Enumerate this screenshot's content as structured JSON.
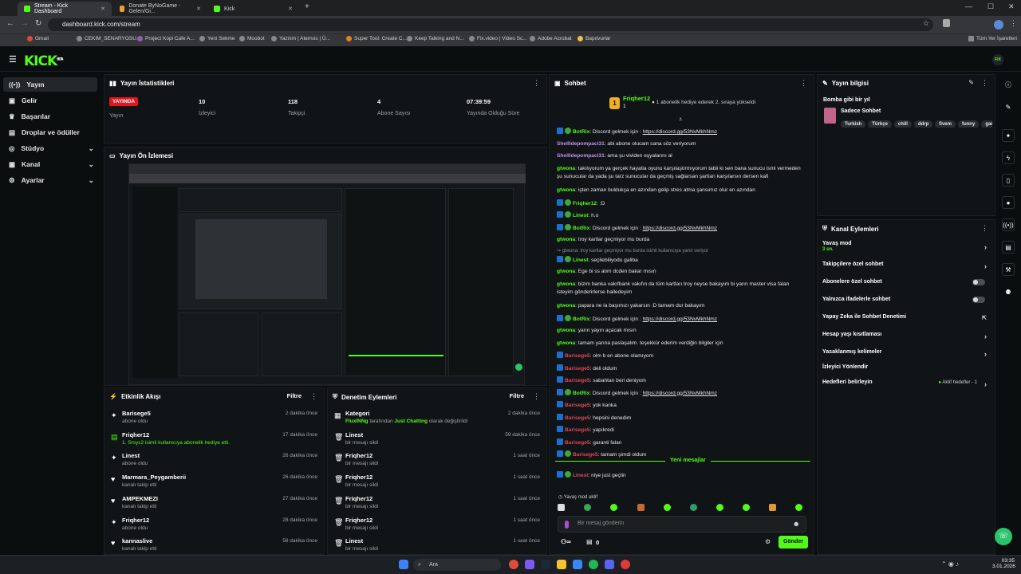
{
  "browser": {
    "tabs": [
      {
        "title": "Stream - Kick Dashboard",
        "active": true
      },
      {
        "title": "Donate ByNoGame - Gelen/Gi...",
        "active": false
      },
      {
        "title": "Kick",
        "active": false
      }
    ],
    "url": "dashboard.kick.com/stream",
    "bookmarks": [
      "Gmail",
      "CEKIM_SENARYOSU...",
      "Project Kopi Cafe A...",
      "Yeni Sekme",
      "Moobot",
      "Yazılım | Aternos | Ü...",
      "Super Tool: Create C...",
      "Keep Talking and N...",
      "Fix.video | Video Sc...",
      "Adobe Acrobat",
      "Bapıtvurlar"
    ],
    "all_bookmarks": "Tüm Yer İşaretleri"
  },
  "kick": {
    "logo": "KICK",
    "logo_sup": "BETA",
    "user_tag": "FIX"
  },
  "sidebar": [
    {
      "label": "Yayın",
      "icon": "broadcast-icon",
      "selected": true
    },
    {
      "label": "Gelir",
      "icon": "wallet-icon"
    },
    {
      "label": "Başarılar",
      "icon": "trophy-icon"
    },
    {
      "label": "Droplar ve ödüller",
      "icon": "gift-icon"
    },
    {
      "label": "Stüdyo",
      "icon": "studio-icon",
      "chevron": true
    },
    {
      "label": "Kanal",
      "icon": "channel-icon",
      "chevron": true
    },
    {
      "label": "Ayarlar",
      "icon": "gear-icon",
      "chevron": true
    }
  ],
  "stats": {
    "title": "Yayın İstatistikleri",
    "live_badge": "YAYINDA",
    "live_label": "Yayın",
    "items": [
      {
        "value": "10",
        "label": "İzleyici"
      },
      {
        "value": "118",
        "label": "Takipçi"
      },
      {
        "value": "4",
        "label": "Abone Sayısı"
      },
      {
        "value": "07:39:59",
        "label": "Yayında Olduğu Süre"
      }
    ]
  },
  "preview": {
    "title": "Yayın Ön İzlemesi"
  },
  "activity": {
    "title": "Etkinlik Akışı",
    "filter": "Filtre",
    "items": [
      {
        "name": "Barisege5",
        "desc": "abone oldu",
        "time": "2 dakika önce",
        "icon": "star-icon"
      },
      {
        "name": "Friqher12",
        "desc": "1. Srsys2 isimli kullanıcıya abonelik hediye etti.",
        "time": "17 dakika önce",
        "icon": "gift-icon",
        "green": true
      },
      {
        "name": "Linest",
        "desc": "abone oldu",
        "time": "26 dakika önce",
        "icon": "star-icon"
      },
      {
        "name": "Marmara_Peygamberii",
        "desc": "kanalı takip etti",
        "time": "26 dakika önce",
        "icon": "heart-icon"
      },
      {
        "name": "AMPEKMEZI",
        "desc": "kanalı takip etti",
        "time": "27 dakika önce",
        "icon": "heart-icon"
      },
      {
        "name": "Friqher12",
        "desc": "abone oldu",
        "time": "28 dakika önce",
        "icon": "star-icon"
      },
      {
        "name": "kannaslive",
        "desc": "kanalı takip etti",
        "time": "58 dakika önce",
        "icon": "heart-icon"
      }
    ]
  },
  "moderation": {
    "title": "Denetim Eylemleri",
    "filter": "Filtre",
    "items": [
      {
        "name": "Kategori",
        "desc_user": "FluxINNg",
        "desc_mid": " tarafından ",
        "desc_cat": "Just Chatting",
        "desc_end": " olarak değiştirildi",
        "time": "2 dakika önce",
        "icon": "category-icon"
      },
      {
        "name": "Linest",
        "desc": "bir mesajı sildi",
        "time": "59 dakika önce",
        "icon": "trash-icon"
      },
      {
        "name": "Friqher12",
        "desc": "bir mesajı sildi",
        "time": "1 saat önce",
        "icon": "trash-icon"
      },
      {
        "name": "Friqher12",
        "desc": "bir mesajı sildi",
        "time": "1 saat önce",
        "icon": "trash-icon"
      },
      {
        "name": "Friqher12",
        "desc": "bir mesajı sildi",
        "time": "1 saat önce",
        "icon": "trash-icon"
      },
      {
        "name": "Friqher12",
        "desc": "bir mesajı sildi",
        "time": "1 saat önce",
        "icon": "trash-icon"
      },
      {
        "name": "Linest",
        "desc": "bir mesajı sildi",
        "time": "1 saat önce",
        "icon": "trash-icon"
      }
    ]
  },
  "chat": {
    "title": "Sohbet",
    "gifter": "Friqher12",
    "gifter_count": "1",
    "gift_msg": "1 abonelik hediye ederek 2. sıraya yükseldi",
    "messages": [
      {
        "user": "BotRix",
        "cls": "u-green",
        "badges": 2,
        "text": "Discord gelmek için : ",
        "link": "https://discord.gg/53NvMkhNmz"
      },
      {
        "user": "Shellldepompaci31",
        "cls": "u-purple",
        "badges": 0,
        "text": "abi abone olucam sana söz veriyorum"
      },
      {
        "user": "Shellldepompaci31",
        "cls": "u-purple",
        "badges": 0,
        "text": "ama şu vividen eşyalarını al"
      },
      {
        "user": "gtwona",
        "cls": "u-green",
        "badges": 0,
        "text": "takılıyorum ya gerçek hayatla oyunu karşılaştırmıyorum tabii ki sen bana sunucu ismi vermeden şu sunucular da yada şu tarz sunucular da geçmiş sağlarsan şartları karşılarsın dersen kafi",
        "lines": 2
      },
      {
        "user": "gtwona",
        "cls": "u-green",
        "badges": 0,
        "text": "işten zaman buldukça en azından gelip stres atma şansımız olur en azından"
      },
      {
        "user": "Friqher12",
        "cls": "u-green",
        "badges": 2,
        "text": ":D"
      },
      {
        "user": "Linest",
        "cls": "u-green",
        "badges": 2,
        "text": "h.o"
      },
      {
        "user": "BotRix",
        "cls": "u-green",
        "badges": 2,
        "text": "Discord gelmek için : ",
        "link": "https://discord.gg/53NvMkhNmz"
      },
      {
        "user": "gtwona",
        "cls": "u-green",
        "badges": 0,
        "text": "troy kartlar geçmiyor mu burda"
      },
      {
        "reply": "gtwona: troy kartlar geçmiyor mu burda isimli kullanıcıya yanıt veriyor"
      },
      {
        "user": "Linest",
        "cls": "u-green",
        "badges": 2,
        "text": "seçilebiliyodu galiba"
      },
      {
        "user": "gtwona",
        "cls": "u-green",
        "badges": 0,
        "text": "Ege bi ss atım dcden bakar mısın"
      },
      {
        "user": "gtwona",
        "cls": "u-green",
        "badges": 0,
        "text": "bizim banka vakıfbank vakıfın da tüm kartları troy neyse bakayım bi yarın master visa falan isteyim gönderirlerse halledeyim",
        "lines": 2
      },
      {
        "user": "gtwona",
        "cls": "u-green",
        "badges": 0,
        "text": "papara ne la başımızı yakarsın :D tamam dur bakayım"
      },
      {
        "user": "BotRix",
        "cls": "u-green",
        "badges": 2,
        "text": "Discord gelmek için : ",
        "link": "https://discord.gg/53NvMkhNmz"
      },
      {
        "user": "gtwona",
        "cls": "u-green",
        "badges": 0,
        "text": "yarın yayın açacak mısın"
      },
      {
        "user": "gtwona",
        "cls": "u-green",
        "badges": 0,
        "text": "tamam yarına paslaşalım. teşekkür ederim verdiğin bilgiler için"
      },
      {
        "user": "Barisege5",
        "cls": "u-red",
        "badges": 1,
        "text": "olm b en abone olamıyom"
      },
      {
        "user": "Barisege5",
        "cls": "u-red",
        "badges": 1,
        "text": "deli oldum"
      },
      {
        "user": "Barisege5",
        "cls": "u-red",
        "badges": 1,
        "text": "sabahtan beri deniyom"
      },
      {
        "user": "BotRix",
        "cls": "u-green",
        "badges": 2,
        "text": "Discord gelmek için : ",
        "link": "https://discord.gg/53NvMkhNmz"
      },
      {
        "user": "Barisege5",
        "cls": "u-red",
        "badges": 1,
        "text": "yok kanka"
      },
      {
        "user": "Barisege5",
        "cls": "u-red",
        "badges": 1,
        "text": "hepsini denedim"
      },
      {
        "user": "Barisege5",
        "cls": "u-red",
        "badges": 1,
        "text": "yapıkredi"
      },
      {
        "user": "Barisege5",
        "cls": "u-red",
        "badges": 1,
        "text": "garanti falan"
      },
      {
        "user": "Barisege5",
        "cls": "u-red",
        "badges": 2,
        "text": "tamam şimdi oldum"
      }
    ],
    "new_messages": "Yeni mesajlar",
    "last": {
      "user": "Linest",
      "text": "niye just geçtin"
    },
    "slow_mode": "Yavaş mod aktif",
    "placeholder": "Bir mesaj gönderin",
    "count_label": "0",
    "send": "Gönder"
  },
  "stream_info": {
    "title": "Yayın bilgisi",
    "stream_title": "Bomba gibi bir yıl",
    "category": "Sadece Sohbet",
    "tags": [
      "Turkish",
      "Türkçe",
      "chill",
      "ddrp",
      "fivem",
      "funny",
      "gar"
    ]
  },
  "channel_actions": {
    "title": "Kanal Eylemleri",
    "items": [
      {
        "label": "Yavaş mod",
        "sub": "3 sn.",
        "kind": "arrow"
      },
      {
        "label": "Takipçilere özel sohbet",
        "kind": "arrow"
      },
      {
        "label": "Abonelere özel sohbet",
        "kind": "toggle"
      },
      {
        "label": "Yalnızca ifadelerle sohbet",
        "kind": "toggle"
      },
      {
        "label": "Yapay Zeka ile Sohbet Denetimi",
        "kind": "external"
      },
      {
        "label": "Hesap yaşı kısıtlaması",
        "kind": "arrow"
      },
      {
        "label": "Yasaklanmış kelimeler",
        "kind": "arrow"
      },
      {
        "label": "İzleyici Yönlendir",
        "kind": "none"
      },
      {
        "label": "Hedefleri belirleyin",
        "kind": "arrow",
        "right": "Aktif hedefler - 1"
      }
    ]
  },
  "taskbar": {
    "search": "Ara",
    "time": "03:35",
    "date": "3.01.2026"
  },
  "colors": {
    "accent": "#53fc18",
    "live": "#e5141f",
    "bg": "#0b0e0f",
    "panel": "#111416"
  }
}
